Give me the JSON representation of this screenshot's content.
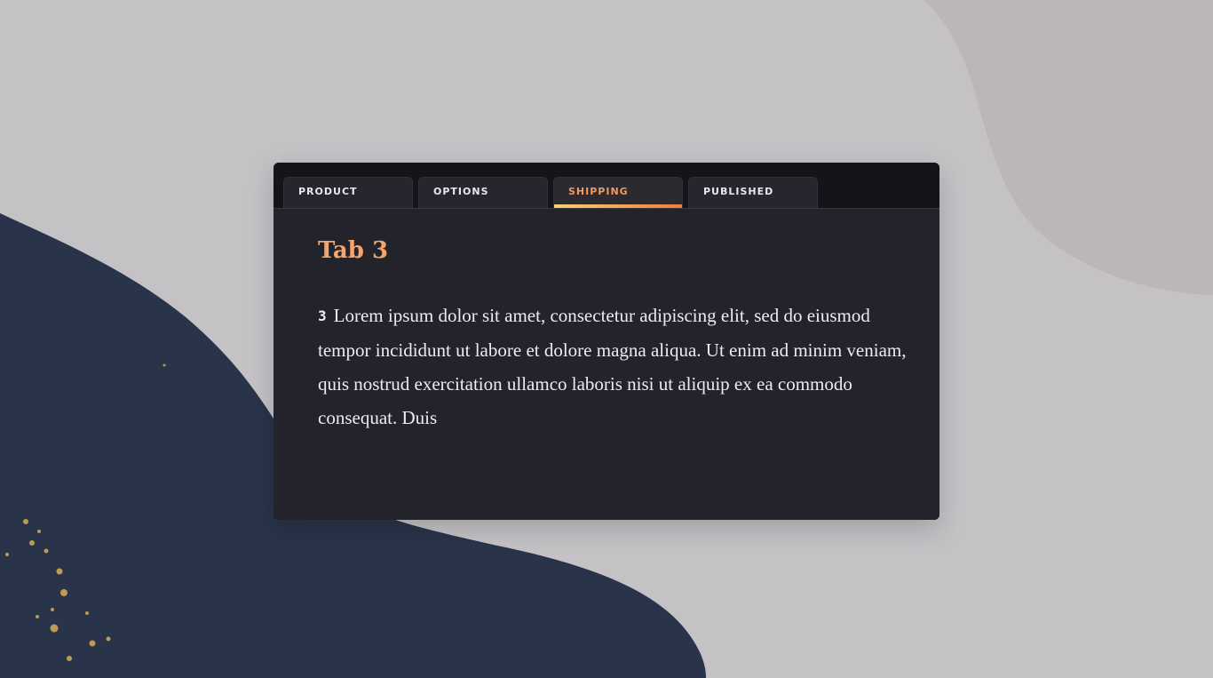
{
  "background": {
    "paper_color": "#c4c2c5",
    "blob_color": "#29334a",
    "accent_dot_color": "#c6a055"
  },
  "tabs": [
    {
      "label": "PRODUCT",
      "active": false
    },
    {
      "label": "OPTIONS",
      "active": false
    },
    {
      "label": "SHIPPING",
      "active": true
    },
    {
      "label": "PUBLISHED",
      "active": false
    }
  ],
  "panel": {
    "title": "Tab 3",
    "number": "3",
    "body": "Lorem ipsum dolor sit amet, consectetur adipiscing elit, sed do eiusmod tempor incididunt ut labore et dolore magna aliqua. Ut enim ad minim veniam, quis nostrud exercitation ullamco laboris nisi ut aliquip ex ea commodo consequat. Duis"
  },
  "colors": {
    "card_bg": "#141419",
    "panel_bg": "#22232b",
    "tab_bg": "#26272e",
    "active_tab_text": "#ef9a5f",
    "title_color": "#f2a66d",
    "text_color": "#ececf2",
    "tab_indicator_start": "#f6cf78",
    "tab_indicator_end": "#f17d3d"
  }
}
